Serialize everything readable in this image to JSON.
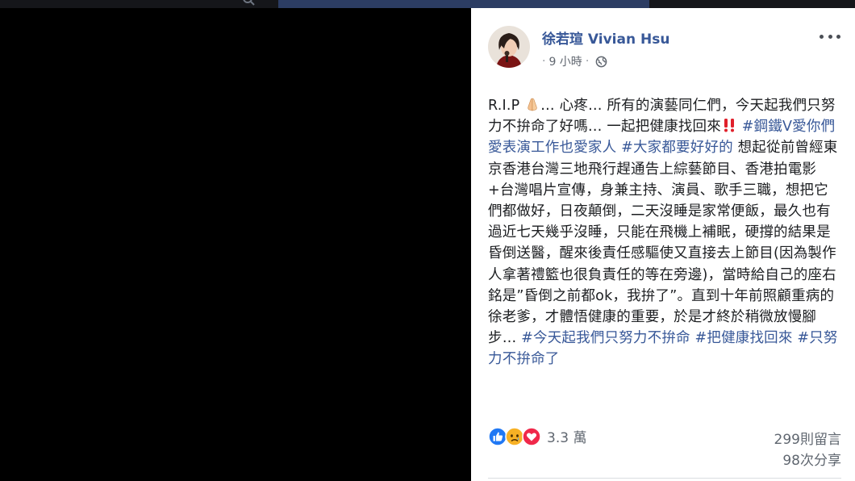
{
  "post": {
    "author": "徐若瑄 Vivian Hsu",
    "timestamp": "9 小時",
    "privacy_icon": "globe-icon",
    "body": [
      {
        "type": "text",
        "text": "R.I.P "
      },
      {
        "type": "emoji",
        "name": "folded-hands-icon",
        "glyph": "🙏"
      },
      {
        "type": "text",
        "text": "… 心疼… 所有的演藝同仁們，今天起我們只努力不拚命了好嗎… 一起把健康找回來"
      },
      {
        "type": "emoji",
        "name": "double-exclamation-icon",
        "glyph": "‼️"
      },
      {
        "type": "text",
        "text": " "
      },
      {
        "type": "hashtag",
        "text": "#鋼鐵V愛你們愛表演工作也愛家人"
      },
      {
        "type": "text",
        "text": " "
      },
      {
        "type": "hashtag",
        "text": "#大家都要好好的"
      },
      {
        "type": "text",
        "text": " 想起從前曾經東京香港台灣三地飛行趕通告上綜藝節目、香港拍電影+台灣唱片宣傳，身兼主持、演員、歌手三職，想把它們都做好，日夜顛倒，二天沒睡是家常便飯，最久也有過近七天幾乎沒睡，只能在飛機上補眠，硬撐的結果是昏倒送醫，醒來後責任感驅使又直接去上節目(因為製作人拿著禮籃也很負責任的等在旁邊)，當時給自己的座右銘是”昏倒之前都ok，我拚了”。直到十年前照顧重病的徐老爹，才體悟健康的重要，於是才終於稍微放慢腳步… "
      },
      {
        "type": "hashtag",
        "text": "#今天起我們只努力不拚命"
      },
      {
        "type": "text",
        "text": " "
      },
      {
        "type": "hashtag",
        "text": "#把健康找回來"
      },
      {
        "type": "text",
        "text": " "
      },
      {
        "type": "hashtag",
        "text": "#只努力不拚命了"
      }
    ],
    "reactions": {
      "icons": [
        "like-icon",
        "sad-icon",
        "love-icon"
      ],
      "count": "3.3 萬"
    },
    "comments": "299則留言",
    "shares": "98次分享"
  },
  "colors": {
    "link": "#385898",
    "text": "#1c1e21",
    "meta": "#606770",
    "like": "#2078f4",
    "love": "#f0284a",
    "sad": "#f7b125"
  }
}
